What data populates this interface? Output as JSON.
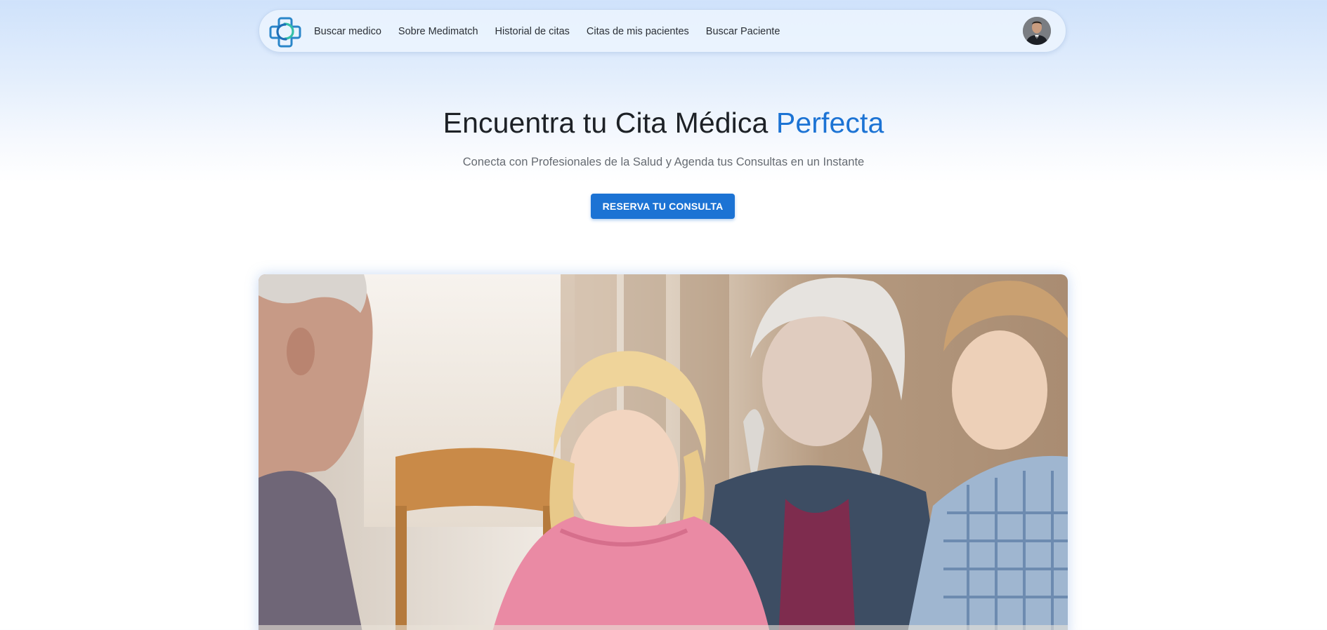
{
  "navbar": {
    "logo_icon": "medical-cross-logo-icon",
    "links": [
      {
        "label": "Buscar medico"
      },
      {
        "label": "Sobre Medimatch"
      },
      {
        "label": "Historial de citas"
      },
      {
        "label": "Citas de mis pacientes"
      },
      {
        "label": "Buscar Paciente"
      }
    ],
    "theme_icon": "moon-icon",
    "avatar_icon": "user-avatar"
  },
  "hero": {
    "title_main": "Encuentra tu Cita Médica ",
    "title_accent": "Perfecta",
    "subtitle": "Conecta con Profesionales de la Salud y Agenda tus Consultas en un Instante",
    "cta_label": "RESERVA TU CONSULTA"
  },
  "colors": {
    "accent": "#1c73d4",
    "text": "#1d2126",
    "muted": "#666b72"
  },
  "photo": {
    "icon": "family-photo"
  }
}
